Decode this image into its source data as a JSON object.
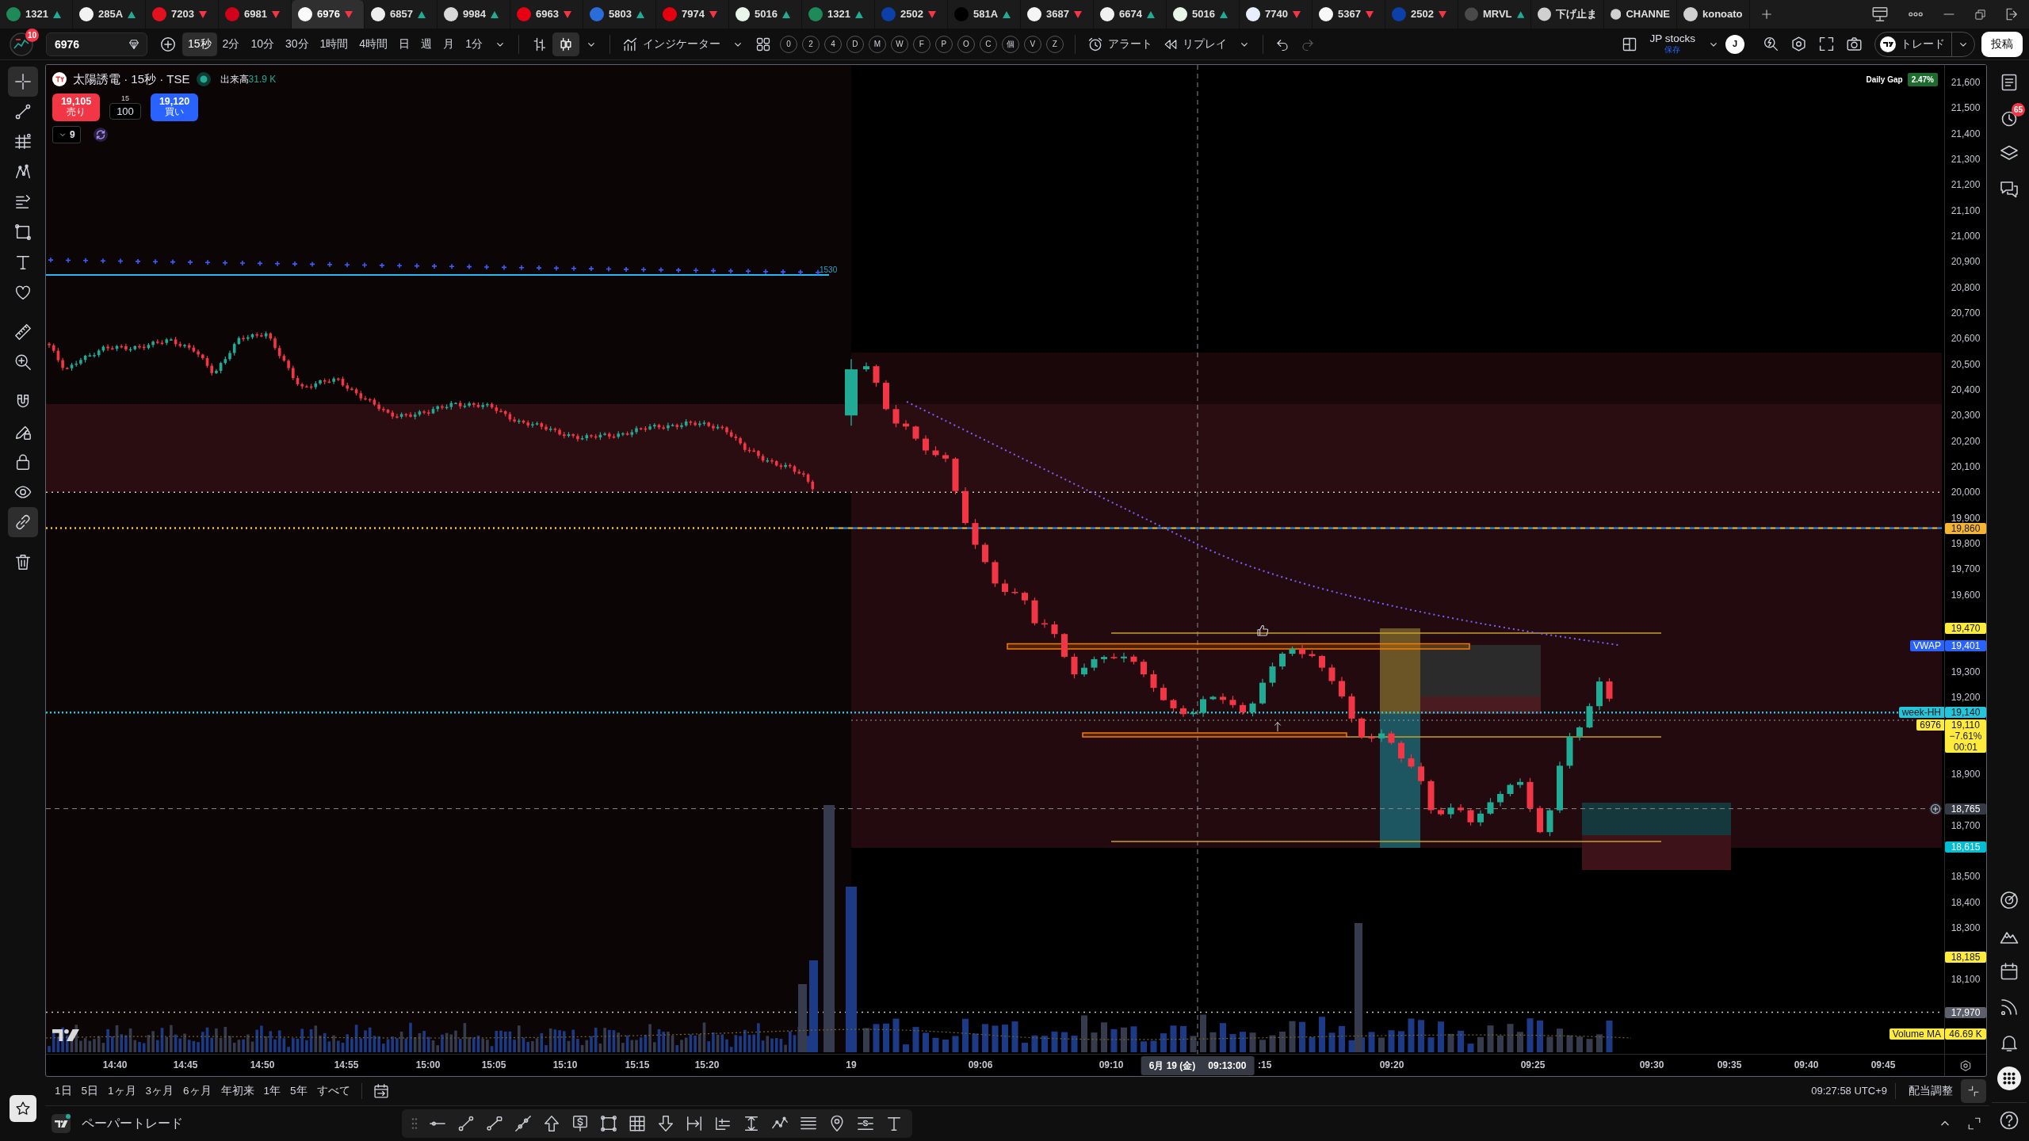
{
  "tabs": [
    {
      "label": "1321",
      "color": "#1e8a5a",
      "rising": true,
      "selected": false
    },
    {
      "label": "285A",
      "color": "#f2f2f2",
      "rising": true,
      "selected": false
    },
    {
      "label": "7203",
      "color": "#e3101e",
      "rising": false,
      "selected": false
    },
    {
      "label": "6981",
      "color": "#d0021b",
      "rising": false,
      "selected": false
    },
    {
      "label": "6976",
      "color": "#fafafa",
      "rising": false,
      "selected": true
    },
    {
      "label": "6857",
      "color": "#eeeeee",
      "rising": true,
      "selected": false
    },
    {
      "label": "9984",
      "color": "#d9d9d9",
      "rising": true,
      "selected": false
    },
    {
      "label": "6963",
      "color": "#e60012",
      "rising": false,
      "selected": false
    },
    {
      "label": "5803",
      "color": "#2a6dd9",
      "rising": true,
      "selected": false
    },
    {
      "label": "7974",
      "color": "#e4000f",
      "rising": false,
      "selected": false
    },
    {
      "label": "5016",
      "color": "#e8f5e9",
      "rising": true,
      "selected": false
    },
    {
      "label": "1321",
      "color": "#1e8a5a",
      "rising": true,
      "selected": false
    },
    {
      "label": "2502",
      "color": "#0d3fa8",
      "rising": false,
      "selected": false
    },
    {
      "label": "581A",
      "color": "#000000",
      "rising": true,
      "selected": false
    },
    {
      "label": "3687",
      "color": "#f5f5f5",
      "rising": false,
      "selected": false
    },
    {
      "label": "6674",
      "color": "#f0f0f0",
      "rising": true,
      "selected": false
    },
    {
      "label": "5016",
      "color": "#e8f5e9",
      "rising": true,
      "selected": false
    },
    {
      "label": "7740",
      "color": "#e8eefc",
      "rising": false,
      "selected": false
    },
    {
      "label": "5367",
      "color": "#f7f7f7",
      "rising": false,
      "selected": false
    },
    {
      "label": "2502",
      "color": "#0d3fa8",
      "rising": false,
      "selected": false
    },
    {
      "label": "MRVL",
      "color": "#4a4a4a",
      "rising": true,
      "selected": false
    },
    {
      "label": "下げ止ま",
      "color": "#d0d0d0",
      "selected": false
    },
    {
      "label": "CHANNE",
      "color": "#d0d0d0",
      "selected": false
    },
    {
      "label": "konoato",
      "color": "#d0d0d0",
      "selected": false
    }
  ],
  "toolbar": {
    "notification_badge": "10",
    "symbol": "6976",
    "intervals": [
      {
        "label": "15秒",
        "selected": true
      },
      {
        "label": "2分",
        "selected": false
      },
      {
        "label": "10分",
        "selected": false
      },
      {
        "label": "30分",
        "selected": false
      },
      {
        "label": "1時間",
        "selected": false
      },
      {
        "label": "4時間",
        "selected": false
      },
      {
        "label": "日",
        "selected": false
      },
      {
        "label": "週",
        "selected": false
      },
      {
        "label": "月",
        "selected": false
      },
      {
        "label": "1分",
        "selected": false
      }
    ],
    "chart_styles": [
      {
        "kind": "bars",
        "selected": false
      },
      {
        "kind": "candles",
        "selected": true
      }
    ],
    "indicators_label": "インジケーター",
    "quick_buttons": [
      "0",
      "2",
      "4",
      "D",
      "M",
      "W",
      "F",
      "P",
      "O",
      "C",
      "個",
      "V",
      "Z"
    ],
    "alert_label": "アラート",
    "replay_label": "リプレイ",
    "layout_name": "JP stocks",
    "layout_status": "保存",
    "user_initial": "J",
    "trade_label": "トレード",
    "publish_label": "投稿"
  },
  "left_tools": [
    {
      "kind": "crosshair",
      "selected": true
    },
    {
      "kind": "trend_line",
      "selected": false
    },
    {
      "kind": "fib",
      "selected": false
    },
    {
      "kind": "pattern",
      "selected": false
    },
    {
      "kind": "forecast",
      "selected": false
    },
    {
      "kind": "shapes",
      "selected": false
    },
    {
      "kind": "text",
      "selected": false
    },
    {
      "kind": "heart",
      "selected": false
    },
    {
      "kind": "ruler",
      "selected": false
    },
    {
      "kind": "zoom",
      "selected": false
    },
    {
      "kind": "magnet",
      "selected": false
    },
    {
      "kind": "stay_drawing",
      "selected": false
    },
    {
      "kind": "lock",
      "selected": false
    },
    {
      "kind": "eye",
      "selected": false
    },
    {
      "kind": "link",
      "selected": true
    },
    {
      "kind": "trash",
      "selected": false
    }
  ],
  "legend": {
    "title": "太陽誘電 · 15秒 · TSE",
    "volume_label": "出来高",
    "volume_value": "31.9 K",
    "sell_price": "19,105",
    "sell_label": "売り",
    "spread": "15",
    "quantity": "100",
    "buy_price": "19,120",
    "buy_label": "買い",
    "collapsed_count": "9"
  },
  "daily_gap": {
    "label": "Daily Gap",
    "value": "2.47%"
  },
  "chart": {
    "line_label": "1530"
  },
  "price_axis": {
    "ticks": [
      "21,600",
      "21,500",
      "21,400",
      "21,300",
      "21,200",
      "21,100",
      "21,000",
      "20,900",
      "20,800",
      "20,700",
      "20,600",
      "20,500",
      "20,400",
      "20,300",
      "20,200",
      "20,100",
      "20,000",
      "19,900",
      "19,800",
      "19,700",
      "19,600",
      "19,300",
      "19,200",
      "18,900",
      "18,700",
      "18,500",
      "18,400",
      "18,300",
      "18,100"
    ],
    "tags": [
      {
        "kind": "price",
        "value": "19,860",
        "color": "#f5b532"
      },
      {
        "kind": "price",
        "value": "19,470",
        "color": "#ffeb3b"
      },
      {
        "kind": "price",
        "name": "VWAP",
        "value": "19,401",
        "color": "#2962ff"
      },
      {
        "kind": "price",
        "name": "week-HH",
        "value": "19,140",
        "color": "#26c6da"
      },
      {
        "kind": "last",
        "name": "6976",
        "value": "19,110",
        "change": "−7.61%",
        "countdown": "00:01",
        "color": "#ffeb3b"
      },
      {
        "kind": "crosshair",
        "value": "18,765",
        "color": "#363a45"
      },
      {
        "kind": "price",
        "value": "18,615",
        "color": "#00bcd4"
      },
      {
        "kind": "price",
        "value": "18,185",
        "color": "#ffeb3b"
      },
      {
        "kind": "price",
        "value": "17,970",
        "color": "#5d606b"
      },
      {
        "kind": "volume",
        "name": "Volume MA",
        "value": "46.69 K",
        "color": "#ffeb3b"
      }
    ]
  },
  "time_axis": {
    "ticks": [
      "14:40",
      "14:45",
      "14:50",
      "14:55",
      "15:00",
      "15:05",
      "15:10",
      "15:15",
      "15:20",
      "19",
      "09:06",
      "09:10",
      ":15",
      "09:20",
      "09:25",
      "09:30",
      "09:35",
      "09:40",
      "09:45"
    ],
    "crosshair_date": "6月 19 (金)",
    "crosshair_time": "09:13:00"
  },
  "ranges": [
    "1日",
    "5日",
    "1ヶ月",
    "3ヶ月",
    "6ヶ月",
    "年初来",
    "1年",
    "5年",
    "すべて"
  ],
  "status": {
    "clock": "09:27:58 UTC+9",
    "adjustment_label": "配当調整"
  },
  "footer": {
    "panel_label": "ペーパートレード"
  },
  "right_panel": {
    "alerts_badge": "65"
  }
}
